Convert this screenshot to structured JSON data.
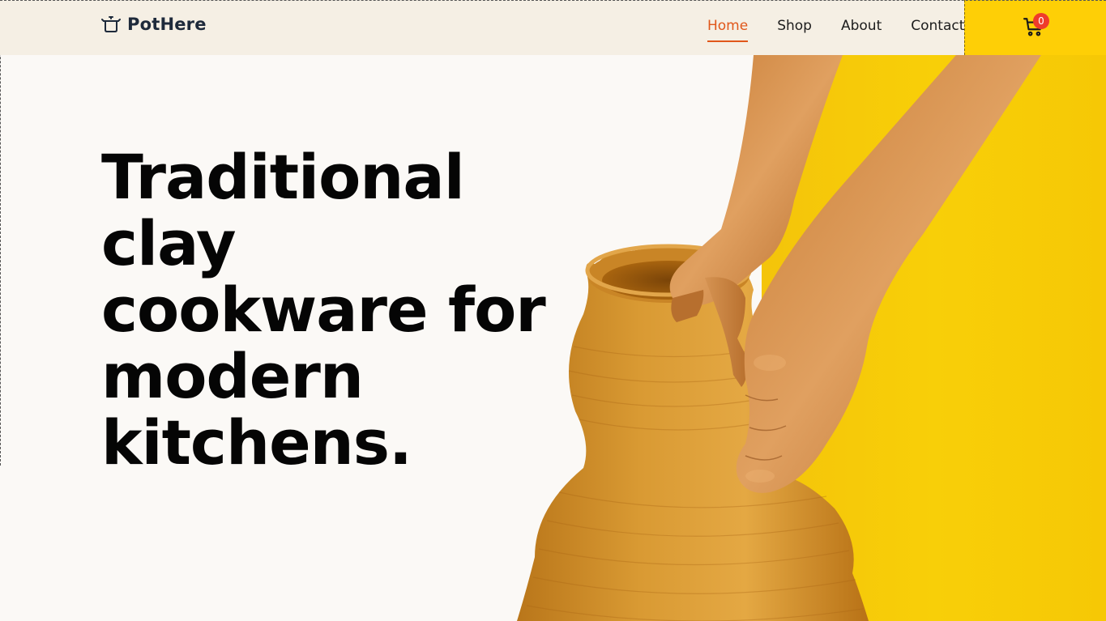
{
  "brand": {
    "name": "PotHere",
    "logo_icon": "pot-icon"
  },
  "nav": {
    "items": [
      {
        "label": "Home",
        "active": true
      },
      {
        "label": "Shop",
        "active": false
      },
      {
        "label": "About",
        "active": false
      },
      {
        "label": "Contact",
        "active": false
      }
    ]
  },
  "cart": {
    "icon": "cart-icon",
    "count": "0",
    "accent_color": "#fecf06",
    "badge_color": "#ef3b2b"
  },
  "hero": {
    "title": "Traditional clay cookware for modern kitchens.",
    "image": "hands-shaping-clay-pot"
  },
  "colors": {
    "active_nav": "#e0571a",
    "header_bg": "#f5efe4",
    "hero_yellow": "#f8cf08"
  }
}
